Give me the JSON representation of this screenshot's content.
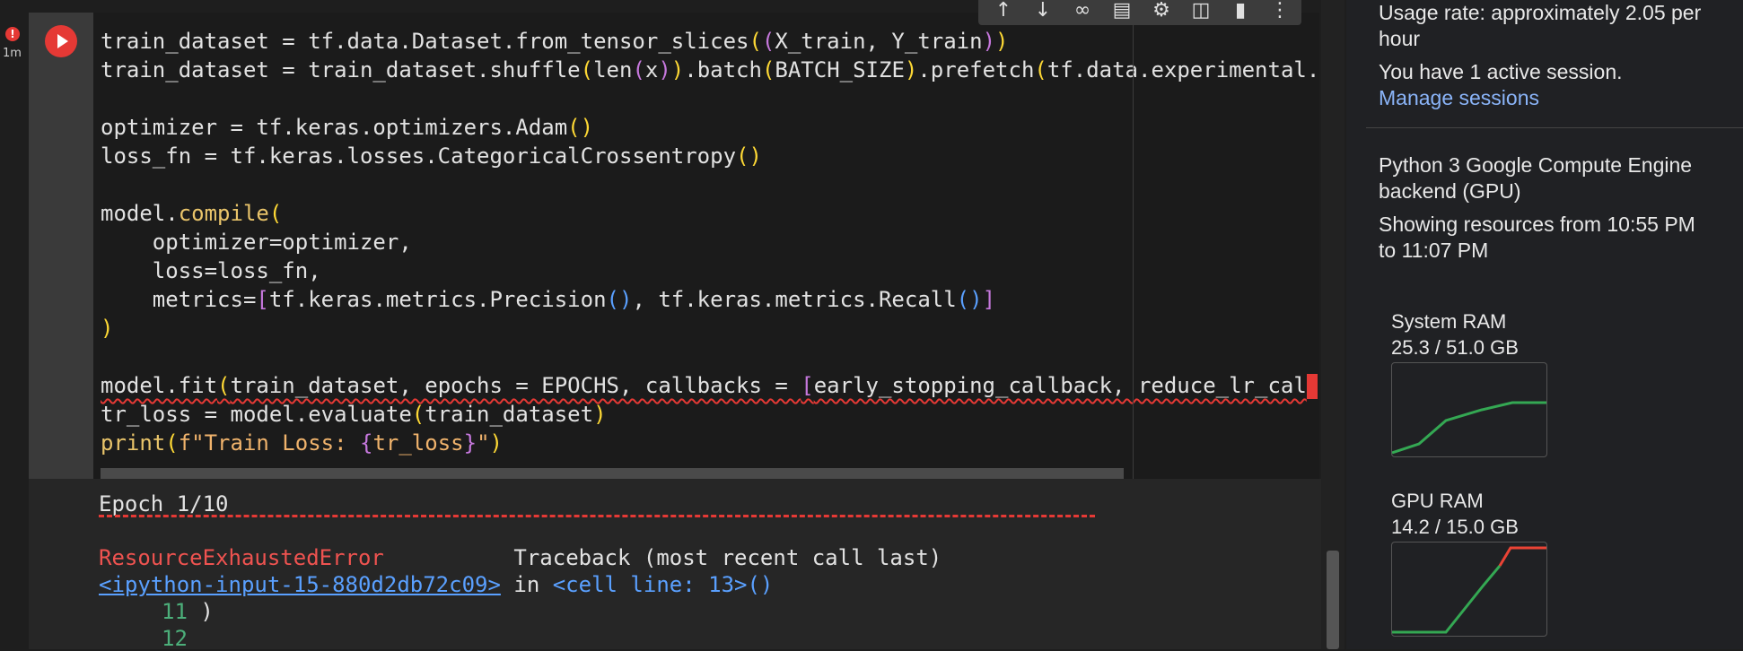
{
  "cell": {
    "exec_time": "1m",
    "error_badge": "!",
    "code_lines": [
      "train_dataset = tf.data.Dataset.from_tensor_slices((X_train, Y_train))",
      "train_dataset = train_dataset.shuffle(len(x)).batch(BATCH_SIZE).prefetch(tf.data.experimental.",
      "",
      "optimizer = tf.keras.optimizers.Adam()",
      "loss_fn = tf.keras.losses.CategoricalCrossentropy()",
      "",
      "model.compile(",
      "    optimizer=optimizer,",
      "    loss=loss_fn,",
      "    metrics=[tf.keras.metrics.Precision(), tf.keras.metrics.Recall()]",
      ")",
      "",
      "model.fit(train_dataset, epochs = EPOCHS, callbacks = [early_stopping_callback, reduce_lr_cal",
      "tr_loss = model.evaluate(train_dataset)",
      "print(f\"Train Loss: {tr_loss}\")"
    ],
    "toolbar_icons": [
      "arrow-up-icon",
      "arrow-down-icon",
      "link-icon",
      "comment-icon",
      "gear-icon",
      "mirror-cell-icon",
      "trash-icon",
      "more-vert-icon"
    ]
  },
  "output": {
    "epoch": "Epoch 1/10",
    "error_name": "ResourceExhaustedError",
    "traceback": "Traceback (most recent call last)",
    "input_link": "<ipython-input-15-880d2db72c09>",
    "in_text": " in ",
    "cell_line": "<cell line: 13>()",
    "line11_num": "11",
    "line11_text": " )",
    "line12_num": "12"
  },
  "panel": {
    "usage_rate_1": "Usage rate: approximately 2.05 per",
    "usage_rate_2": "hour",
    "active_session": "You have 1 active session.",
    "manage_sessions": "Manage sessions",
    "backend_1": "Python 3 Google Compute Engine",
    "backend_2": "backend (GPU)",
    "showing_1": "Showing resources from 10:55 PM",
    "showing_2": "to 11:07 PM",
    "system_ram_label": "System RAM",
    "system_ram_value": "25.3 / 51.0 GB",
    "gpu_ram_label": "GPU RAM",
    "gpu_ram_value": "14.2 / 15.0 GB"
  },
  "colors": {
    "system_ram_line": "#34a853",
    "gpu_ram_line": "#34a853",
    "gpu_ram_peak": "#ea4335"
  }
}
